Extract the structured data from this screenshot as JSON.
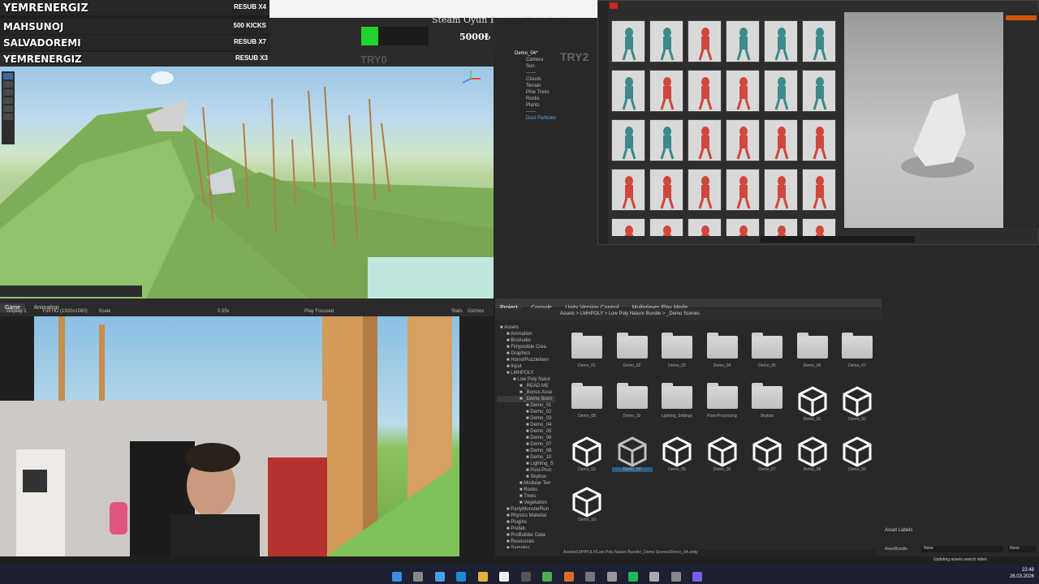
{
  "overlay": {
    "rows": [
      {
        "name": "YEMRENERGIZ",
        "count": "RESUB X4"
      },
      {
        "name": "MAHSUNOJ",
        "count": "500 KICKS"
      },
      {
        "name": "SALVADOREMI",
        "count": "RESUB X7"
      },
      {
        "name": "YEMRENERGIZ",
        "count": "RESUB X3"
      }
    ],
    "goal_title": "Steam Oyun Projesi Giderleri",
    "goal_amount": "5000₺ (25.00%)",
    "goal_progress": 0.25,
    "goal_color": "#22d12e",
    "side_label_left": "TRY0",
    "side_label_right": "TRY2"
  },
  "hierarchy": {
    "root": "Demo_04*",
    "items": [
      "Camera",
      "Sun",
      "------",
      "Clouds",
      "Terrain",
      "Pine Trees",
      "Rocks",
      "Plants",
      "------",
      "Dust Particles"
    ]
  },
  "game_view": {
    "tabs": [
      "Game",
      "Animation"
    ],
    "display": "Display 1",
    "resolution": "Full HD (1920x1080)",
    "scale_label": "Scale",
    "scale_value": "0.55x",
    "play_mode": "Play Focused",
    "stats": "Stats",
    "gizmos": "Gizmos"
  },
  "project": {
    "tabs": [
      "Project",
      "Console",
      "Unity Version Control",
      "Multiplayer Play Mode"
    ],
    "breadcrumb": [
      "Assets",
      "LMHPOLY",
      "Low Poly Nature Bundle",
      "_Demo Scenes"
    ],
    "tree": [
      {
        "label": "Assets",
        "indent": 0
      },
      {
        "label": "Animation",
        "indent": 1
      },
      {
        "label": "BroAudio",
        "indent": 1
      },
      {
        "label": "Fimposible Crea",
        "indent": 1
      },
      {
        "label": "Graphics",
        "indent": 1
      },
      {
        "label": "HorrorPuzzleItem",
        "indent": 1
      },
      {
        "label": "Input",
        "indent": 1
      },
      {
        "label": "LMHPOLY",
        "indent": 1
      },
      {
        "label": "Low Poly Natur",
        "indent": 2
      },
      {
        "label": "_READ ME",
        "indent": 3
      },
      {
        "label": "_Bonus Asse",
        "indent": 3
      },
      {
        "label": "_Demo Scen",
        "indent": 3
      },
      {
        "label": "Demo_01",
        "indent": 4
      },
      {
        "label": "Demo_02",
        "indent": 4
      },
      {
        "label": "Demo_03",
        "indent": 4
      },
      {
        "label": "Demo_04",
        "indent": 4
      },
      {
        "label": "Demo_05",
        "indent": 4
      },
      {
        "label": "Demo_06",
        "indent": 4
      },
      {
        "label": "Demo_07",
        "indent": 4
      },
      {
        "label": "Demo_08",
        "indent": 4
      },
      {
        "label": "Demo_10",
        "indent": 4
      },
      {
        "label": "Lighting_S",
        "indent": 4
      },
      {
        "label": "Post-Proc",
        "indent": 4
      },
      {
        "label": "Skybox",
        "indent": 4
      },
      {
        "label": "Modular Terr",
        "indent": 3
      },
      {
        "label": "Rocks",
        "indent": 3
      },
      {
        "label": "Trees",
        "indent": 3
      },
      {
        "label": "Vegetation",
        "indent": 3
      },
      {
        "label": "PartyMonsterRun",
        "indent": 1
      },
      {
        "label": "Physics Material",
        "indent": 1
      },
      {
        "label": "Plugins",
        "indent": 1
      },
      {
        "label": "Prefab",
        "indent": 1
      },
      {
        "label": "ProBuilder Data",
        "indent": 1
      },
      {
        "label": "Resources",
        "indent": 1
      },
      {
        "label": "Samples",
        "indent": 1
      },
      {
        "label": "Saves",
        "indent": 1
      }
    ],
    "folders": [
      "Demo_01",
      "Demo_02",
      "Demo_03",
      "Demo_04",
      "Demo_05",
      "Demo_06",
      "Demo_07",
      "Demo_08",
      "Demo_10",
      "Lighting_Settings",
      "Post-Processing",
      "Skybox"
    ],
    "scenes": [
      "Demo_01",
      "Demo_02",
      "Demo_03",
      "Demo_04",
      "Demo_05",
      "Demo_06",
      "Demo_07",
      "Demo_08",
      "Demo_09",
      "Demo_10"
    ],
    "selected_scene": "Demo_04",
    "footer_path": "Assets/LMHPOLY/Low Poly Nature Bundle/_Demo Scenes/Demo_04.unity"
  },
  "inspector": {
    "asset_labels": "Asset Labels",
    "asset_bundle_label": "AssetBundle",
    "asset_bundle_value": "None",
    "asset_bundle_variant": "None",
    "status": "Updating assets search index"
  },
  "taskbar": {
    "time": "22:48",
    "date": "26.03.2026"
  },
  "colors": {
    "editor_bg": "#282828",
    "panel": "#383838",
    "accent": "#2c5d87",
    "taskbar": "#1c2030"
  }
}
